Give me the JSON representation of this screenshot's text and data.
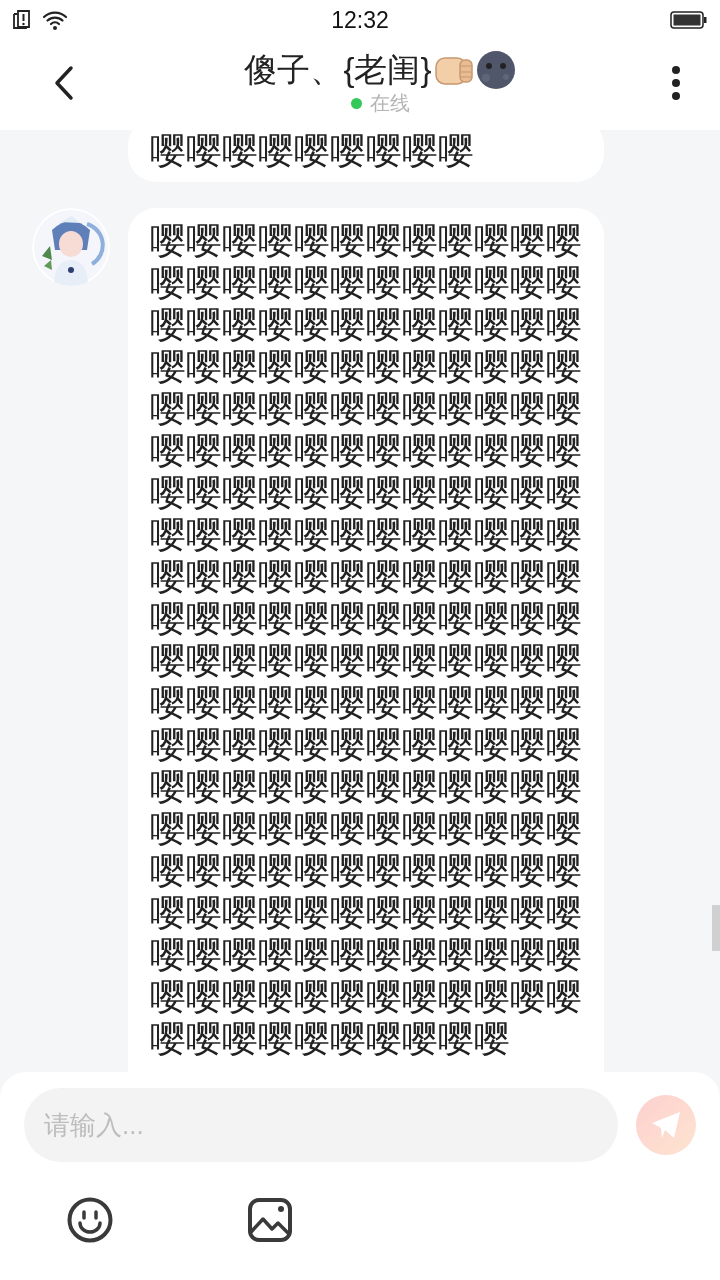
{
  "status_bar": {
    "time": "12:32"
  },
  "header": {
    "title": "傻子、{老闺}",
    "online": true,
    "status": "在线"
  },
  "messages": [
    {
      "text": "嘤嘤嘤嘤嘤嘤嘤嘤嘤",
      "show_avatar": false
    },
    {
      "text": "嘤嘤嘤嘤嘤嘤嘤嘤嘤嘤嘤嘤嘤嘤嘤嘤嘤嘤嘤嘤嘤嘤嘤嘤嘤嘤嘤嘤嘤嘤嘤嘤嘤嘤嘤嘤嘤嘤嘤嘤嘤嘤嘤嘤嘤嘤嘤嘤嘤嘤嘤嘤嘤嘤嘤嘤嘤嘤嘤嘤嘤嘤嘤嘤嘤嘤嘤嘤嘤嘤嘤嘤嘤嘤嘤嘤嘤嘤嘤嘤嘤嘤嘤嘤嘤嘤嘤嘤嘤嘤嘤嘤嘤嘤嘤嘤嘤嘤嘤嘤嘤嘤嘤嘤嘤嘤嘤嘤嘤嘤嘤嘤嘤嘤嘤嘤嘤嘤嘤嘤嘤嘤嘤嘤嘤嘤嘤嘤嘤嘤嘤嘤嘤嘤嘤嘤嘤嘤嘤嘤嘤嘤嘤嘤嘤嘤嘤嘤嘤嘤嘤嘤嘤嘤嘤嘤嘤嘤嘤嘤嘤嘤嘤嘤嘤嘤嘤嘤嘤嘤嘤嘤嘤嘤嘤嘤嘤嘤嘤嘤嘤嘤嘤嘤嘤嘤嘤嘤嘤嘤嘤嘤嘤嘤嘤嘤嘤嘤嘤嘤嘤嘤嘤嘤嘤嘤嘤嘤嘤嘤嘤嘤嘤嘤嘤嘤嘤嘤嘤嘤嘤嘤嘤嘤嘤嘤嘤嘤嘤嘤嘤嘤嘤嘤嘤嘤嘤嘤",
      "show_avatar": true
    }
  ],
  "composer": {
    "placeholder": "请输入..."
  }
}
